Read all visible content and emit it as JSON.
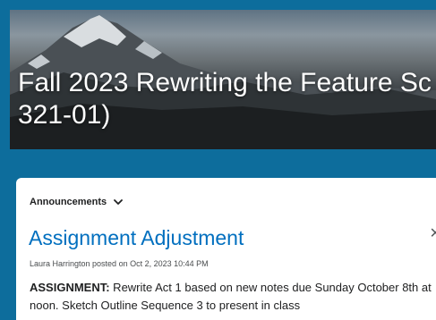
{
  "course": {
    "title_line1": "Fall 2023 Rewriting the Feature Sc",
    "title_line2": "321-01)"
  },
  "widget": {
    "heading": "Announcements"
  },
  "announcement": {
    "title": "Assignment Adjustment",
    "meta": "Laura Harrington posted on Oct 2, 2023 10:44 PM",
    "body_label": "ASSIGNMENT:",
    "body_text": " Rewrite Act 1 based on new notes due Sunday October 8th at noon. Sketch Outline Sequence 3 to present in class"
  },
  "icons": {
    "widget_menu": "chevron-down-icon",
    "dismiss": "close-icon"
  },
  "colors": {
    "page_background": "#0d6d9c",
    "link": "#006fbf",
    "card": "#ffffff"
  }
}
